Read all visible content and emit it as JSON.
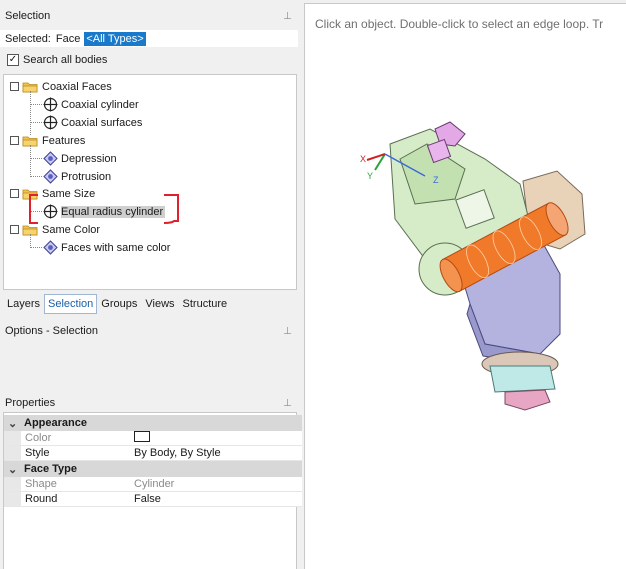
{
  "selection_panel": {
    "title": "Selection",
    "selected_label": "Selected:",
    "selected_value": "Face",
    "type_filter": "<All Types>",
    "search_all_label": "Search all bodies",
    "search_all_checked": true
  },
  "tree": {
    "groups": [
      {
        "label": "Coaxial Faces",
        "children": [
          "Coaxial cylinder",
          "Coaxial surfaces"
        ],
        "child_icon": "crosshair-circle-icon"
      },
      {
        "label": "Features",
        "children": [
          "Depression",
          "Protrusion"
        ],
        "child_icon": "diamond-icon"
      },
      {
        "label": "Same Size",
        "children": [
          "Equal radius cylinder"
        ],
        "child_icon": "crosshair-circle-icon"
      },
      {
        "label": "Same Color",
        "children": [
          "Faces with same color"
        ],
        "child_icon": "diamond-icon"
      }
    ],
    "highlighted_item": "Equal radius cylinder"
  },
  "tabs": [
    "Layers",
    "Selection",
    "Groups",
    "Views",
    "Structure"
  ],
  "active_tab": "Selection",
  "options_panel": {
    "title": "Options - Selection"
  },
  "properties_panel": {
    "title": "Properties",
    "sections": [
      {
        "label": "Appearance",
        "rows": [
          {
            "key": "Color",
            "value": "",
            "dim": true,
            "swatch": "#ffffff"
          },
          {
            "key": "Style",
            "value": "By Body, By Style",
            "dim": false
          }
        ]
      },
      {
        "label": "Face Type",
        "rows": [
          {
            "key": "Shape",
            "value": "Cylinder",
            "dim": true
          },
          {
            "key": "Round",
            "value": "False",
            "dim": false
          }
        ]
      }
    ]
  },
  "viewport": {
    "hint": "Click an object. Double-click to select an edge loop. Tr",
    "axis_labels": {
      "x": "X",
      "y": "Y",
      "z": "Z"
    }
  },
  "colors": {
    "accent": "#1979ca",
    "annotation": "#e0202a",
    "selected_face": "#f07a2a"
  }
}
